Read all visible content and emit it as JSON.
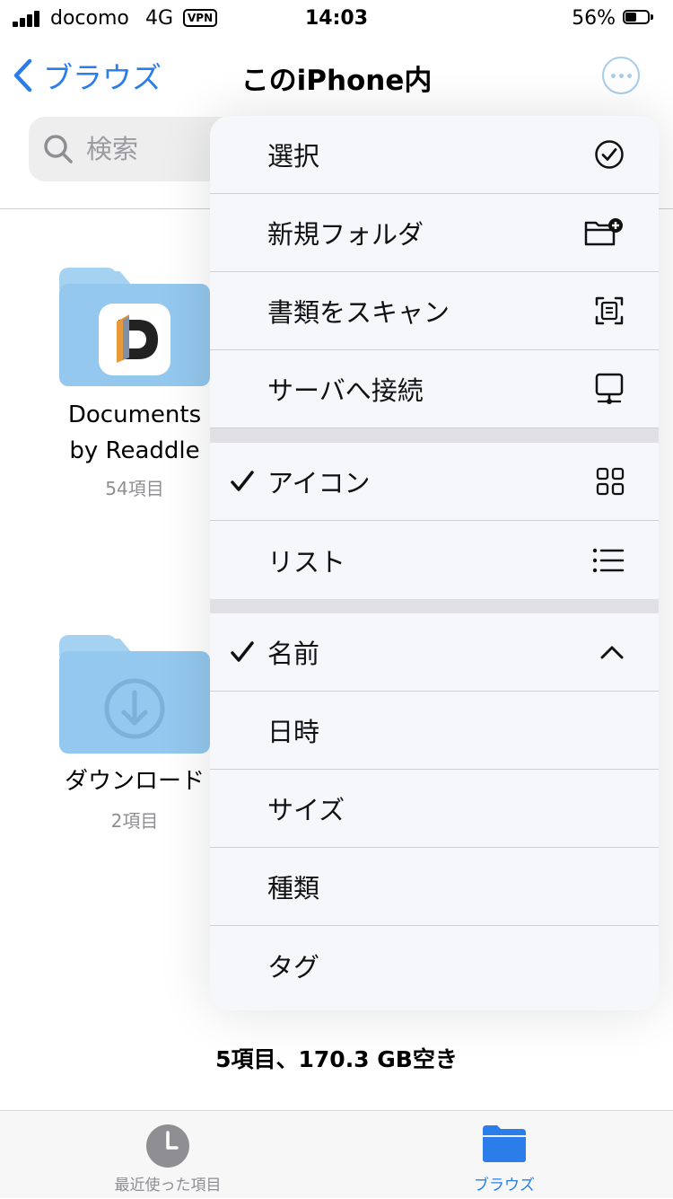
{
  "status_bar": {
    "carrier": "docomo",
    "network": "4G",
    "vpn": "VPN",
    "time": "14:03",
    "battery_percent": "56%",
    "battery_level": 0.56
  },
  "nav": {
    "back_label": "ブラウズ",
    "title": "このiPhone内"
  },
  "search": {
    "placeholder": "検索"
  },
  "files": [
    {
      "name_line1": "Documents",
      "name_line2": "by Readdle",
      "count": "54項目"
    },
    {
      "name": "ダウンロード",
      "count": "2項目"
    }
  ],
  "menu": {
    "actions": [
      {
        "label": "選択",
        "icon": "checkmark-circle-icon"
      },
      {
        "label": "新規フォルダ",
        "icon": "folder-add-icon"
      },
      {
        "label": "書類をスキャン",
        "icon": "scan-document-icon"
      },
      {
        "label": "サーバへ接続",
        "icon": "server-icon"
      }
    ],
    "views": [
      {
        "label": "アイコン",
        "checked": true,
        "icon": "grid-icon"
      },
      {
        "label": "リスト",
        "checked": false,
        "icon": "list-icon"
      }
    ],
    "sort": [
      {
        "label": "名前",
        "checked": true,
        "icon": "chevron-up-icon"
      },
      {
        "label": "日時",
        "checked": false
      },
      {
        "label": "サイズ",
        "checked": false
      },
      {
        "label": "種類",
        "checked": false
      },
      {
        "label": "タグ",
        "checked": false
      }
    ]
  },
  "footer": {
    "status": "5項目、170.3 GB空き"
  },
  "tabbar": {
    "recents_label": "最近使った項目",
    "browse_label": "ブラウズ",
    "active_color": "#2b7de9",
    "inactive_color": "#8e8e93"
  }
}
